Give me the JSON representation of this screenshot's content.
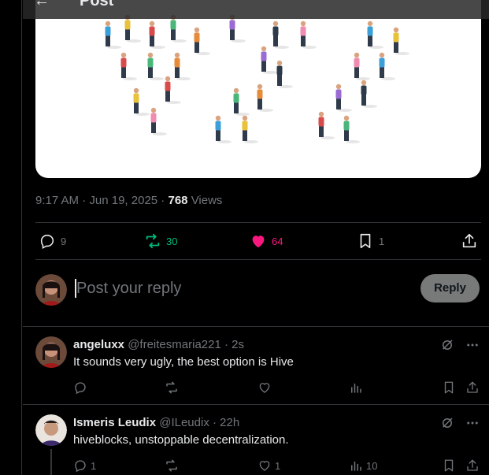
{
  "header": {
    "back_icon": "arrow-left-icon",
    "title": "Post"
  },
  "post": {
    "time": "9:17 AM",
    "date": "Jun 19, 2025",
    "views_count": "768",
    "views_label": "Views",
    "stats": {
      "replies": "9",
      "reposts": "30",
      "likes": "64",
      "bookmarks": "1"
    },
    "colors": {
      "repost_active": "#00ba7c",
      "like_active": "#f91880",
      "muted": "#71767b"
    }
  },
  "composer": {
    "placeholder": "Post your reply",
    "reply_button": "Reply"
  },
  "replies": [
    {
      "name": "angeluxx",
      "handle": "@freitesmaria221",
      "time": "2s",
      "text": "It sounds very ugly, the best option is Hive",
      "counts": {
        "replies": "",
        "reposts": "",
        "likes": "",
        "views": ""
      }
    },
    {
      "name": "Ismeris Leudix",
      "handle": "@ILeudix",
      "time": "22h",
      "text": "hiveblocks, unstoppable decentralization.",
      "counts": {
        "replies": "1",
        "reposts": "",
        "likes": "1",
        "views": "10"
      }
    }
  ]
}
